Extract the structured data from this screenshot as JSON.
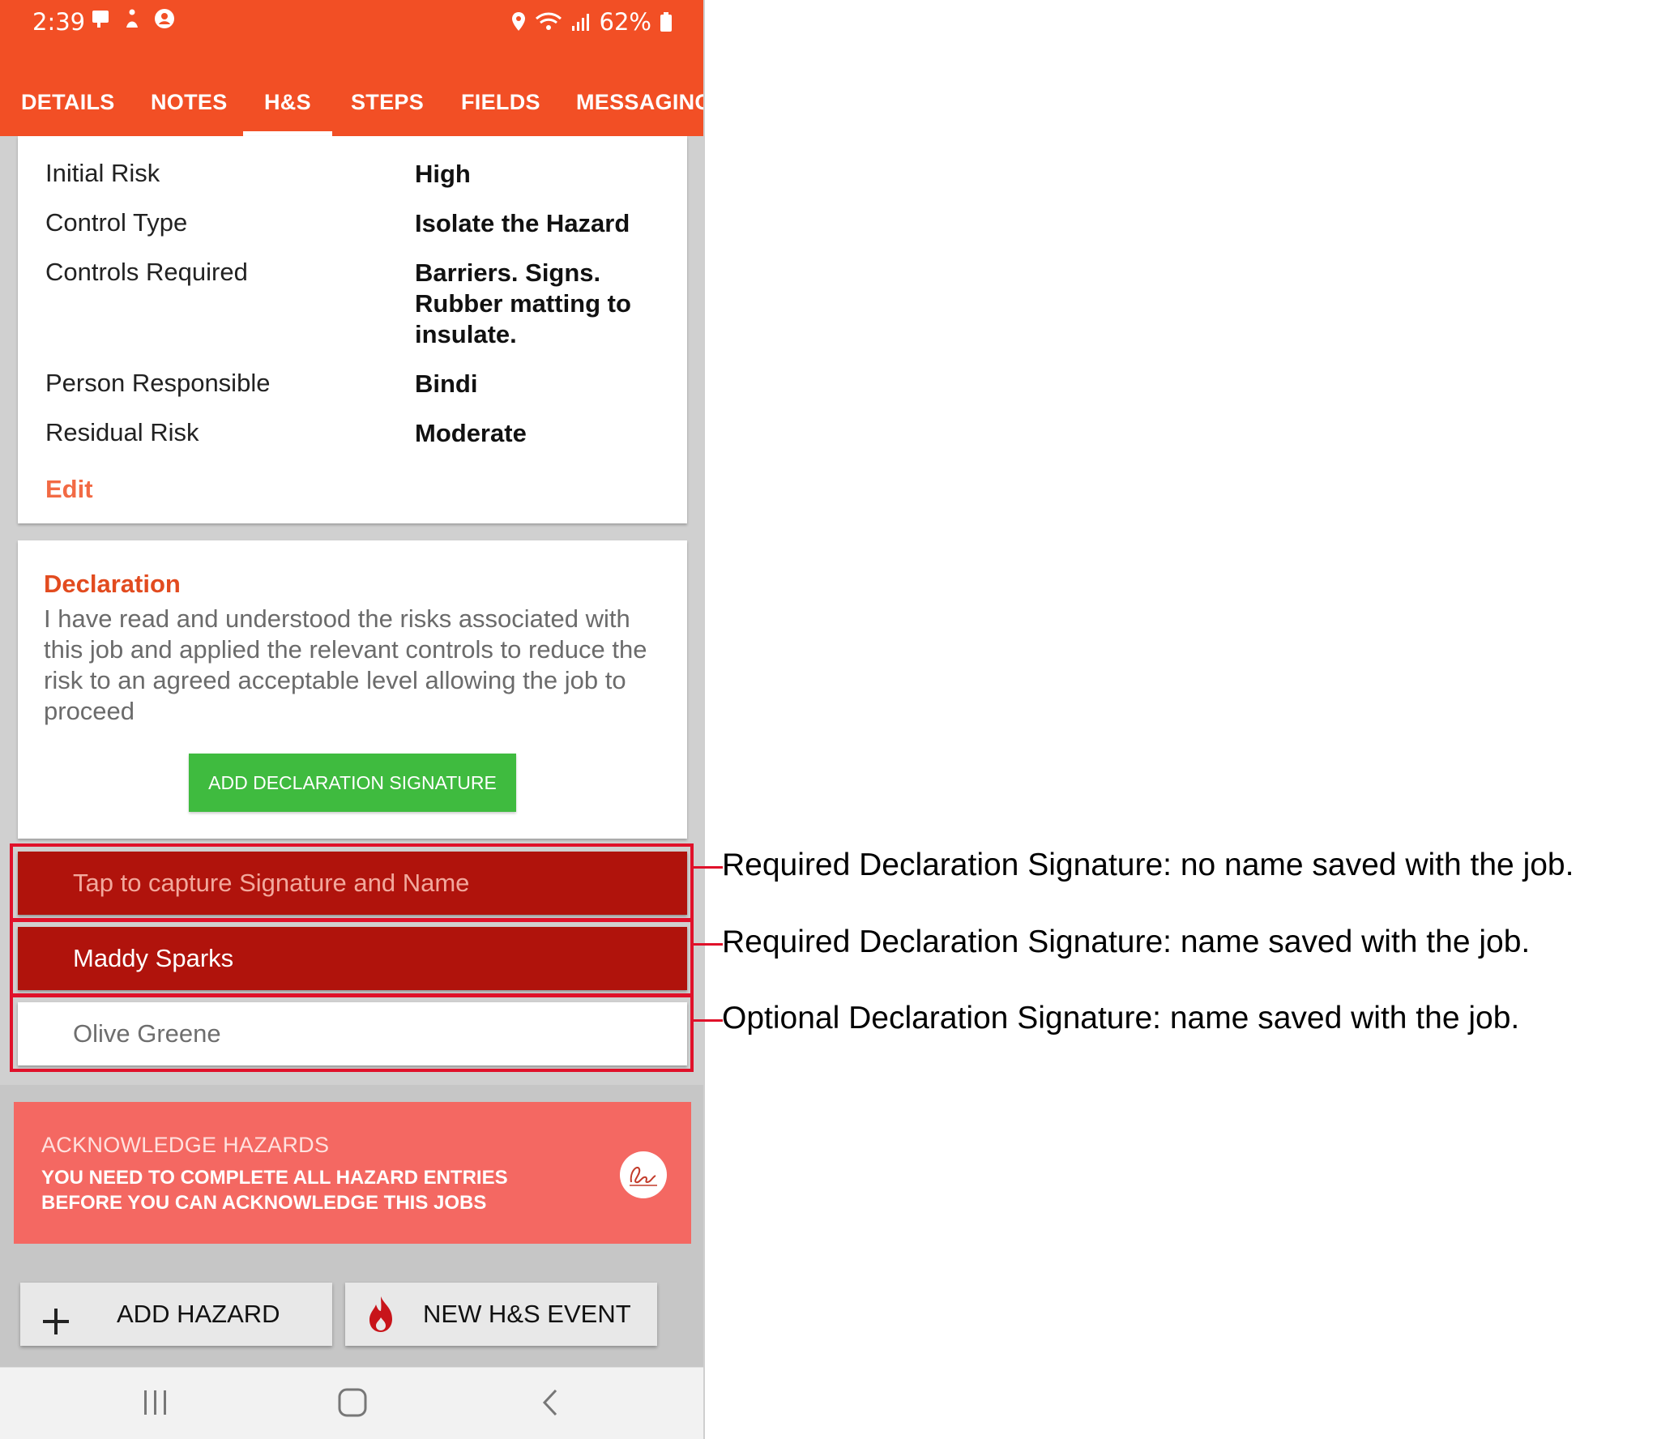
{
  "status_bar": {
    "time": "2:39",
    "battery": "62%"
  },
  "tabs": [
    {
      "label": "DETAILS"
    },
    {
      "label": "NOTES"
    },
    {
      "label": "H&S"
    },
    {
      "label": "STEPS"
    },
    {
      "label": "FIELDS"
    },
    {
      "label": "MESSAGING"
    }
  ],
  "active_tab": "H&S",
  "hazard": {
    "rows": [
      {
        "label": "Initial Risk",
        "value": "High"
      },
      {
        "label": "Control Type",
        "value": "Isolate the Hazard"
      },
      {
        "label": "Controls Required",
        "value": "Barriers. Signs. Rubber matting to insulate."
      },
      {
        "label": "Person Responsible",
        "value": "Bindi"
      },
      {
        "label": "Residual Risk",
        "value": "Moderate"
      }
    ],
    "edit_label": "Edit"
  },
  "declaration": {
    "title": "Declaration",
    "text": "I have read and understood the risks associated with this job and applied the relevant controls to reduce the risk to an agreed acceptable level allowing the job to proceed",
    "button_label": "ADD DECLARATION SIGNATURE"
  },
  "signatures": [
    {
      "text": "Tap to capture Signature and Name",
      "required": true
    },
    {
      "text": "Maddy Sparks",
      "required": true
    },
    {
      "text": "Olive Greene",
      "required": false
    }
  ],
  "acknowledge": {
    "title": "ACKNOWLEDGE HAZARDS",
    "message": "YOU NEED TO COMPLETE ALL HAZARD ENTRIES BEFORE YOU CAN ACKNOWLEDGE THIS JOBS"
  },
  "actions": {
    "add_hazard": "ADD HAZARD",
    "new_event": "NEW H&S EVENT"
  },
  "annotations": [
    "Required Declaration Signature: no name saved with the job.",
    "Required Declaration Signature: name saved with the job.",
    "Optional Declaration Signature: name saved with the job."
  ],
  "colors": {
    "brand_orange": "#f24f25",
    "required_red": "#b0130c",
    "highlight_red": "#e0112a",
    "declaration_green": "#3fbb3f",
    "acknowledge_salmon": "#f46862"
  }
}
